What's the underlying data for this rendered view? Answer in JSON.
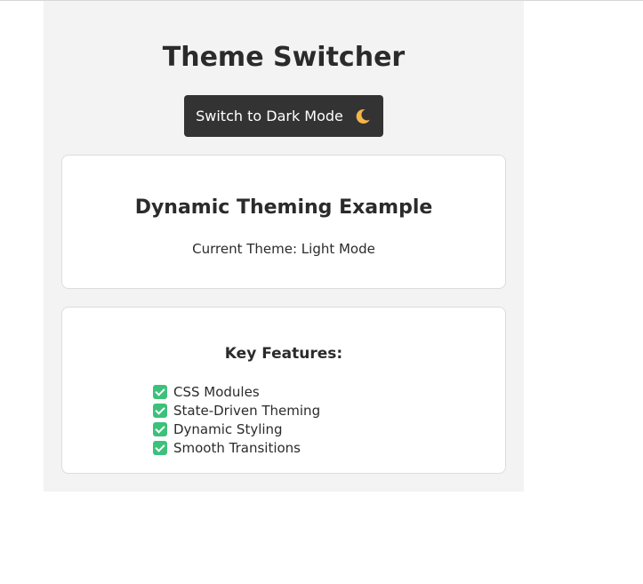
{
  "header": {
    "title": "Theme Switcher",
    "toggle_label": "Switch to Dark Mode",
    "toggle_icon": "moon-icon"
  },
  "theme_card": {
    "heading": "Dynamic Theming Example",
    "current_theme": "Current Theme: Light Mode"
  },
  "features_card": {
    "heading": "Key Features:",
    "items": [
      {
        "icon": "check-icon",
        "label": "CSS Modules"
      },
      {
        "icon": "check-icon",
        "label": "State-Driven Theming"
      },
      {
        "icon": "check-icon",
        "label": "Dynamic Styling"
      },
      {
        "icon": "check-icon",
        "label": "Smooth Transitions"
      }
    ]
  },
  "colors": {
    "panel_background": "#f3f3f3",
    "button_background": "#333333",
    "check_green": "#3cc17a"
  }
}
